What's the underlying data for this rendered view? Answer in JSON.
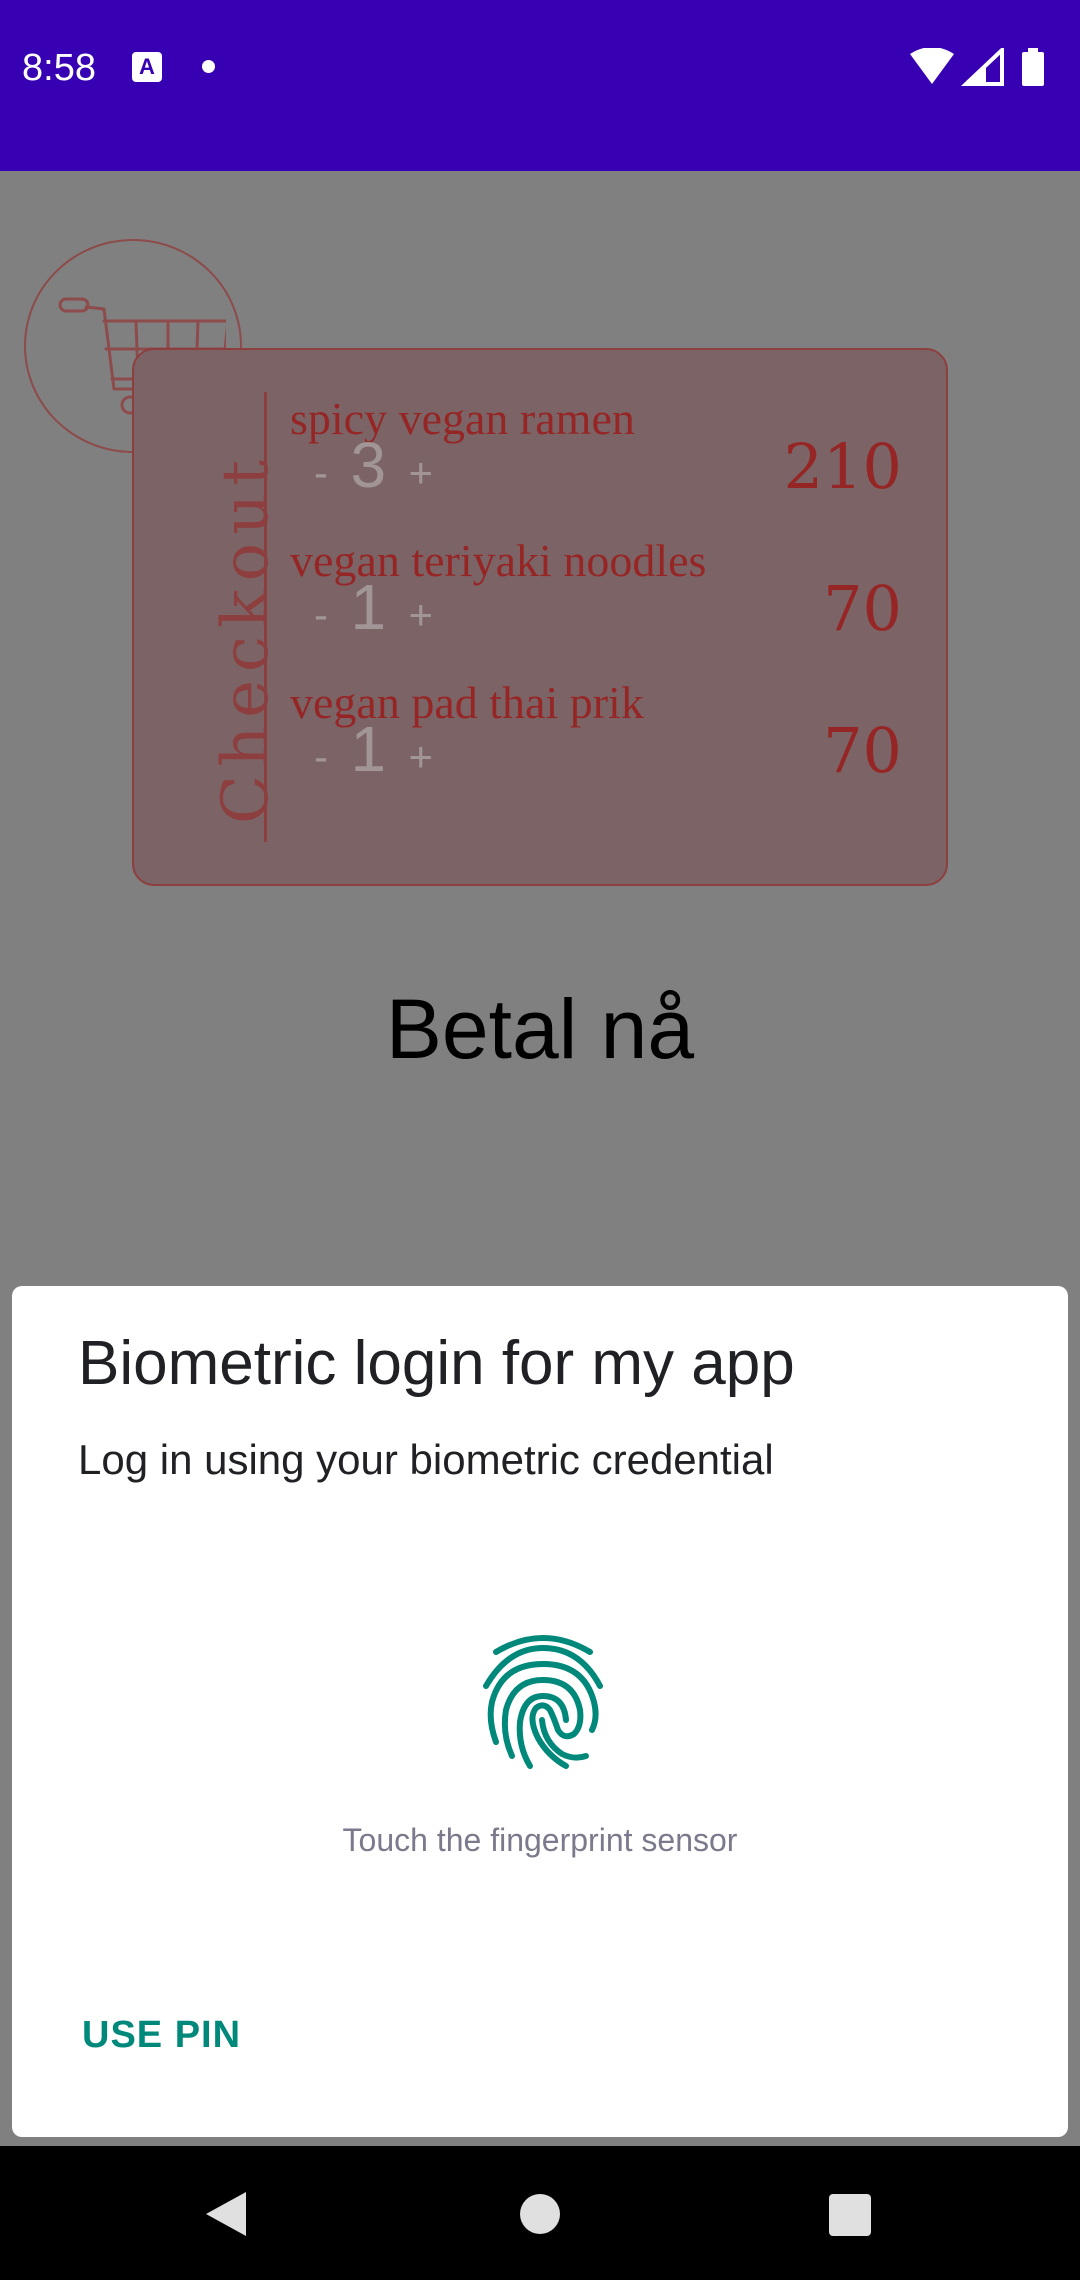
{
  "status_bar": {
    "time": "8:58",
    "icons": [
      "text-a-icon",
      "notification-dot-icon",
      "wifi-icon",
      "signal-icon",
      "battery-icon"
    ]
  },
  "checkout": {
    "label": "Checkout",
    "items": [
      {
        "name": "spicy vegan ramen",
        "minus": "-",
        "qty": "3",
        "plus": "+",
        "price": "210"
      },
      {
        "name": "vegan teriyaki noodles",
        "minus": "-",
        "qty": "1",
        "plus": "+",
        "price": "70"
      },
      {
        "name": "vegan pad thai prik",
        "minus": "-",
        "qty": "1",
        "plus": "+",
        "price": "70"
      }
    ]
  },
  "pay_button": "Betal nå",
  "biometric_dialog": {
    "title": "Biometric login for my app",
    "subtitle": "Log in using your biometric credential",
    "hint": "Touch the fingerprint sensor",
    "negative_button": "USE PIN"
  },
  "colors": {
    "status_bar": "#3700b3",
    "accent": "#00897b",
    "item_text": "#962626",
    "scrim": "#808080"
  }
}
